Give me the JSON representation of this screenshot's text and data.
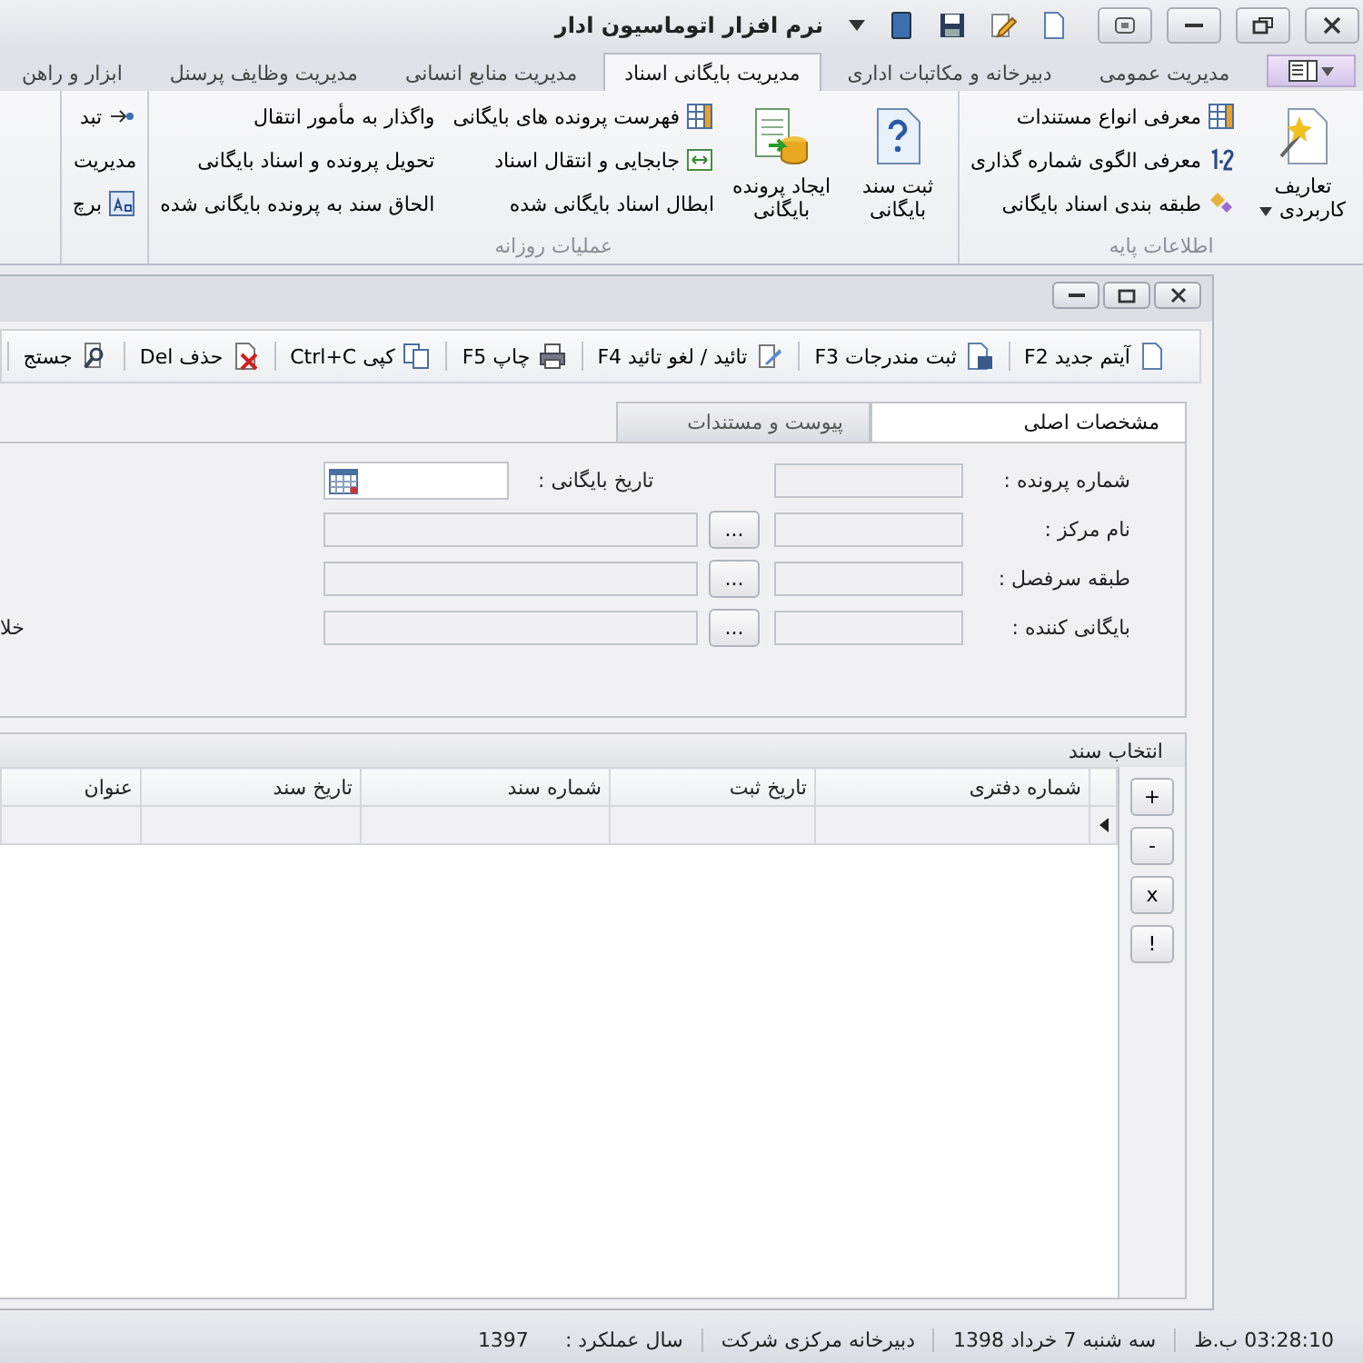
{
  "window": {
    "title": "نرم افزار اتوماسیون ادار"
  },
  "ribbon_tabs": [
    {
      "label": "مدیریت عمومی",
      "selected": false
    },
    {
      "label": "دبیرخانه و مکاتبات اداری",
      "selected": false
    },
    {
      "label": "مدیریت بایگانی اسناد",
      "selected": true
    },
    {
      "label": "مدیریت منابع انسانی",
      "selected": false
    },
    {
      "label": "مدیریت وظایف پرسنل",
      "selected": false
    },
    {
      "label": "ابزار و راهن",
      "selected": false
    }
  ],
  "ribbon_groups": [
    {
      "title": "اطلاعات پایه",
      "items": [
        {
          "kind": "large",
          "label": "تعاریف کاربردی",
          "dropdown": true
        },
        {
          "kind": "column",
          "entries": [
            "معرفی انواع مستندات",
            "معرفی الگوی شماره گذاری",
            "طبقه بندی اسناد بایگانی"
          ]
        }
      ]
    },
    {
      "title": "عملیات روزانه",
      "items": [
        {
          "kind": "large",
          "label": "ثبت سند بایگانی",
          "dropdown": false
        },
        {
          "kind": "large",
          "label": "ایجاد پرونده بایگانی",
          "dropdown": false
        },
        {
          "kind": "column",
          "entries": [
            "فهرست پرونده های بایگانی",
            "جابجایی و انتقال اسناد",
            "ابطال اسناد بایگانی شده"
          ]
        },
        {
          "kind": "column",
          "entries": [
            "واگذار به مأمور انتقال",
            "تحویل پرونده و اسناد بایگانی",
            "الحاق سند به پرونده بایگانی شده"
          ]
        }
      ]
    },
    {
      "items": [
        {
          "kind": "column",
          "entries": [
            "تبد",
            "مدیریت",
            "برچ"
          ]
        }
      ]
    }
  ],
  "toolbar": [
    "آیتم جدید F2",
    "ثبت مندرجات F3",
    "تائید / لغو تائید F4",
    "چاپ F5",
    "کپی Ctrl+C",
    "حذف Del",
    "جستج"
  ],
  "form_tabs": [
    {
      "label": "مشخصات اصلی",
      "selected": true
    },
    {
      "label": "پیوست و مستندات",
      "selected": false
    }
  ],
  "form": {
    "rows": [
      {
        "kind": "date",
        "label": "شماره پرونده :",
        "date_label": "تاریخ بایگانی :"
      },
      {
        "kind": "lookup",
        "label": "نام مرکز :",
        "button": "..."
      },
      {
        "kind": "lookup",
        "label": "طبقه سرفصل :",
        "button": "..."
      },
      {
        "kind": "lookup",
        "label": "بایگانی کننده :",
        "button": "...",
        "side_label": "خلا"
      }
    ]
  },
  "documents": {
    "title": "انتخاب سند",
    "side_buttons": [
      "+",
      "-",
      "x",
      "!"
    ],
    "columns": [
      "شماره دفتری",
      "تاریخ ثبت",
      "شماره سند",
      "تاریخ سند",
      "عنوان"
    ]
  },
  "status_bar": [
    "03:28:10 ب.ظ",
    "سه شنبه 7 خرداد 1398",
    "دبیرخانه مرکزی شرکت",
    "سال عملکرد :",
    "1397"
  ]
}
